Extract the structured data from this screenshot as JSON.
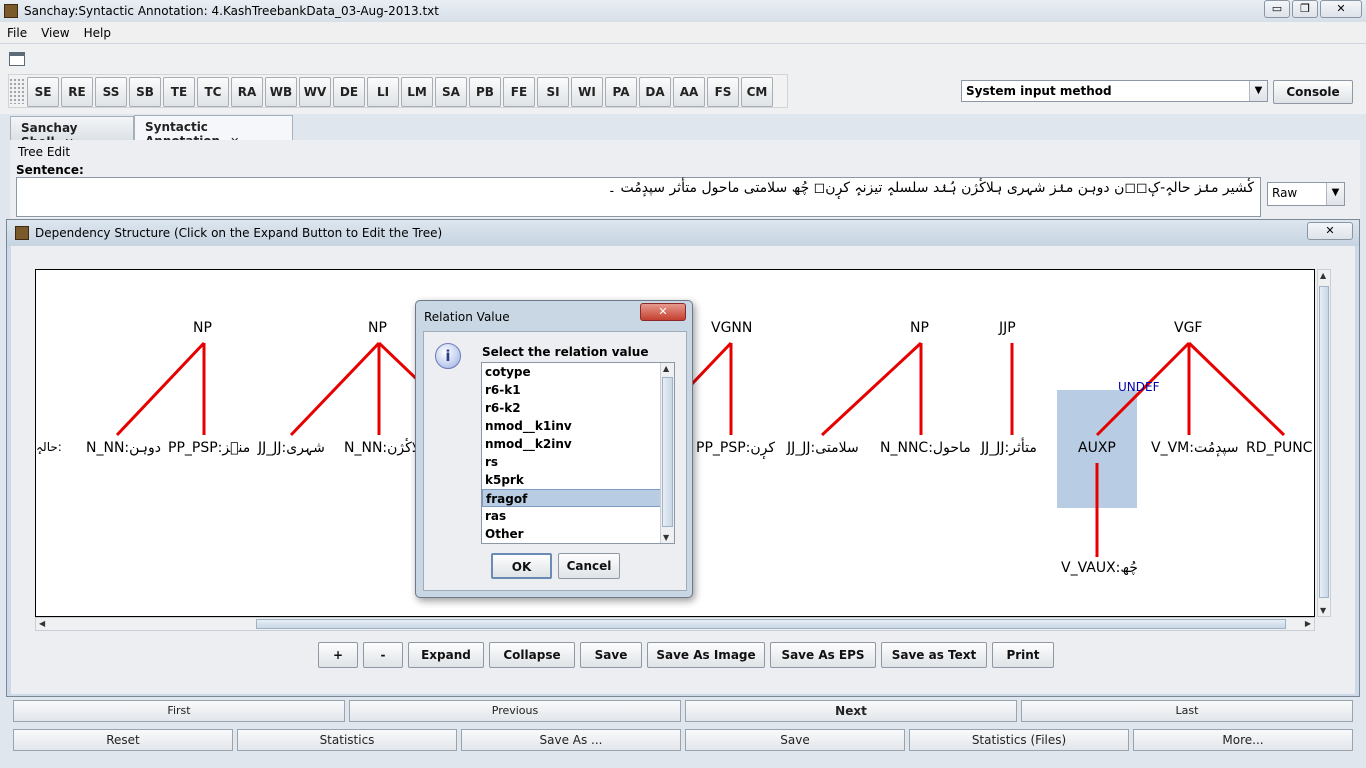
{
  "window": {
    "title": "Sanchay:Syntactic Annotation: 4.KashTreebankData_03-Aug-2013.txt",
    "min": "▭",
    "max": "❐",
    "close": "✕"
  },
  "menu": [
    "File",
    "View",
    "Help"
  ],
  "toolbar": {
    "buttons": [
      "SE",
      "RE",
      "SS",
      "SB",
      "TE",
      "TC",
      "RA",
      "WB",
      "WV",
      "DE",
      "LI",
      "LM",
      "SA",
      "PB",
      "FE",
      "SI",
      "WI",
      "PA",
      "DA",
      "AA",
      "FS",
      "CM"
    ],
    "input_method": "System input method",
    "console": "Console"
  },
  "tabs": [
    {
      "label": "Sanchay Shell",
      "close": "✕"
    },
    {
      "label": "Syntactic Annotation",
      "close": "✕"
    }
  ],
  "tree_edit": {
    "group_label": "Tree Edit",
    "sentence_label": "Sentence:",
    "sentence": "کٔشیر منٛز حالہٕ-کٕ◻◻ن دوہن منٛز شہری ہلاکٔژن ہُنٛد سلسلہٕ تیزنہٕ کرٕن◻ چُھ سلامتی ماحول متأثر سپدٕمُت ۔",
    "format": "Raw"
  },
  "dependency": {
    "title": "Dependency Structure (Click on the Expand Button to Edit the Tree)",
    "close": "✕",
    "nodes": {
      "np1": "NP",
      "np2": "NP",
      "vgnn": "VGNN",
      "np3": "NP",
      "jjp": "JJP",
      "vgf": "VGF",
      "leaf_a": "حالہٕ:",
      "leaf_b": "N_NN:دوہن",
      "leaf_c": "PP_PSP:منٛز",
      "leaf_d": "JJ_JJ:شہری",
      "leaf_e": "N_NN:ہلاکٔژن",
      "leaf_f": "PP_PSP:کرٕن",
      "leaf_g": "JJ_JJ:سلامتی",
      "leaf_h": "N_NNC:ماحول",
      "leaf_i": "JJ_JJ:متأثر",
      "leaf_j": "AUXP",
      "leaf_k": "V_VM:سپدٕمُت",
      "leaf_l": "RD_PUNC:",
      "leaf_m": "V_VAUX:چُھ"
    },
    "edge_label": "UNDEF",
    "buttons": [
      "+",
      "-",
      "Expand",
      "Collapse",
      "Save",
      "Save As Image",
      "Save As EPS",
      "Save as Text",
      "Print"
    ]
  },
  "dialog": {
    "title": "Relation Value",
    "close": "✕",
    "prompt": "Select the relation value",
    "items": [
      "cotype",
      "r6-k1",
      "r6-k2",
      "nmod__k1inv",
      "nmod__k2inv",
      "rs",
      "k5prk",
      "fragof",
      "ras",
      "Other"
    ],
    "selected": "fragof",
    "ok": "OK",
    "cancel": "Cancel"
  },
  "nav": {
    "row1": [
      "First",
      "Previous",
      "Next",
      "Last"
    ],
    "row2": [
      "Reset",
      "Statistics",
      "Save As ...",
      "Save",
      "Statistics (Files)",
      "More..."
    ]
  },
  "colors": {
    "edge": "#e60000",
    "selection": "#b8cde4",
    "edge_label": "#0000aa"
  }
}
